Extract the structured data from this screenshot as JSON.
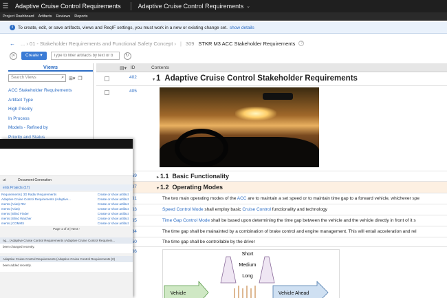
{
  "header": {
    "app_title": "Adaptive Cruise Control Requirements",
    "module_title": "Adaptive Cruise Control Requirements"
  },
  "subnav": [
    "Project Dashboard",
    "Artifacts",
    "Reviews",
    "Reports"
  ],
  "info_bar": {
    "message": "To create, edit, or save artifacts, views and ReqIF settings, you must work in a new or existing change set.",
    "link": "show details"
  },
  "breadcrumb": {
    "parent": "... › 01 - Stakeholder Requirements and Functional Safety Concept ›",
    "id": "309",
    "current": "STKR M3 ACC Stakeholder Requirements"
  },
  "toolbar": {
    "create_label": "Create",
    "filter_placeholder": "Type to filter artifacts by text or b"
  },
  "sidebar": {
    "title": "Views",
    "search_placeholder": "Search Views",
    "views": [
      "ACC Stakeholder Requirements",
      "Artifact Type",
      "High Priority",
      "In Process",
      "Models - Refined by",
      "Priority and Status"
    ]
  },
  "grid": {
    "col_id": "ID",
    "col_contents": "Contents",
    "rows": [
      {
        "id": "402",
        "number": "1",
        "text": "Adaptive Cruise Control Stakeholder Requirements"
      },
      {
        "id": "405",
        "text": ""
      },
      {
        "id": "469",
        "number": "1.1",
        "text": "Basic Functionality"
      },
      {
        "id": "407",
        "number": "1.2",
        "text": "Operating Modes"
      },
      {
        "id": "461",
        "pre": "The two main operating modes of the ",
        "link": "ACC",
        "post": " are to maintain a set speed or to maintain time gap to a forward vehicle, whichever spe"
      },
      {
        "id": "463",
        "link": "Speed Control Mode",
        "post": " shall employ basic ",
        "link2": "Cruise Control",
        "post2": " functionality and technology"
      },
      {
        "id": "465",
        "link": "Time Gap Control Mode",
        "post": " shall be based upon determining the time gap between the vehicle and the vehicle directly in front of it s"
      },
      {
        "id": "484",
        "text": "The time gap shall be mainainted by a combination of brake control and engine management. This will entail acceleration and rel"
      },
      {
        "id": "460",
        "text": "The time gap shall be controllable by the driver"
      },
      {
        "id": "466",
        "text": ""
      }
    ]
  },
  "diagram": {
    "labels": [
      "Short",
      "Medium",
      "Long"
    ],
    "vehicle": "Vehicle",
    "vehicle_ahead": "Vehicle Ahead"
  },
  "overlay": {
    "tabs": [
      "ut",
      "Document Generation"
    ],
    "projects_header": "ents Projects (17)",
    "items": [
      {
        "name": "Requirements | 3D Radar Requirements",
        "action": "Create or show artifact"
      },
      {
        "name": "Adaptive Cruise Control Requirements (Adaptive...",
        "action": "Create or show artifact"
      },
      {
        "name": "ments (Arias) RM",
        "action": "Create or show artifact"
      },
      {
        "name": "ments (Arias)",
        "action": "Create or show artifact"
      },
      {
        "name": "ments | Blind Finder",
        "action": "Create or show artifact"
      },
      {
        "name": "ments | Blind Watcher",
        "action": "Create or show artifact"
      },
      {
        "name": "ments | COMMS",
        "action": "Create or show artifact"
      }
    ],
    "pager": "Page 1 of 3 | Next ›",
    "section1": "ng... (Adaptive Cruise Control Requirements (Adaptive Cruise Control Requirem...",
    "msg1": "been changed recently.",
    "section2": "Adaptive Cruise Control Requirements (Adaptive Cruise Control Requirements (0)",
    "msg2": "been added recently."
  },
  "colors": {
    "topbar": "#1f1f1f",
    "accent": "#2b6cc4",
    "selected_row": "#fdf0e2"
  }
}
